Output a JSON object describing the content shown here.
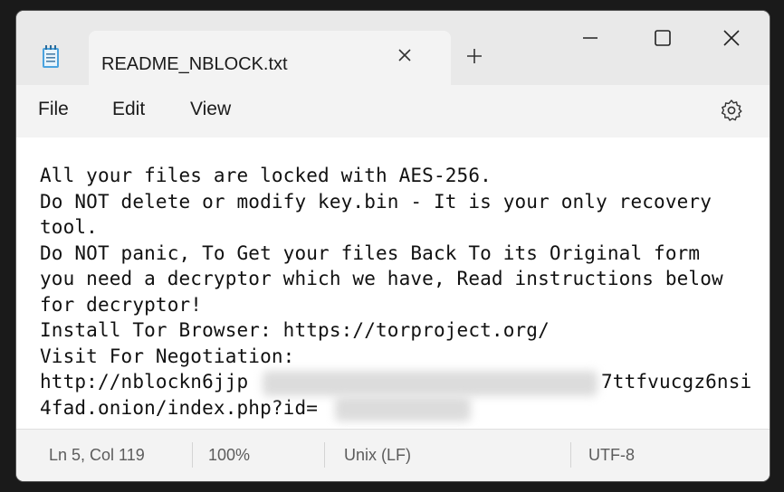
{
  "window": {
    "tab_title": "README_NBLOCK.txt",
    "new_tab_icon": "plus-icon",
    "tab_close_icon": "close-icon",
    "app_icon": "notepad-icon",
    "controls": [
      "minimize-icon",
      "maximize-icon",
      "close-icon"
    ]
  },
  "menu": {
    "file": "File",
    "edit": "Edit",
    "view": "View",
    "settings_icon": "gear-icon"
  },
  "editor": {
    "lines": [
      "All your files are locked with AES-256.",
      "Do NOT delete or modify key.bin - It is your only recovery",
      "tool.",
      "Do NOT panic, To Get your files Back To its Original form",
      "you need a decryptor which we have, Read instructions below",
      "for decryptor!",
      "Install Tor Browser: https://torproject.org/",
      "Visit For Negotiation:",
      "http://nblockn6jjp",
      "4fad.onion/index.php?id="
    ],
    "url_tail": "7ttfvucgz6nsi"
  },
  "status": {
    "position": "Ln 5, Col 119",
    "zoom": "100%",
    "line_ending": "Unix (LF)",
    "encoding": "UTF-8"
  },
  "colors": {
    "titlebar": "#e9e9e9",
    "tab": "#f3f3f3",
    "editor_bg": "#ffffff",
    "text": "#111111",
    "status_text": "#5c5c5c"
  }
}
